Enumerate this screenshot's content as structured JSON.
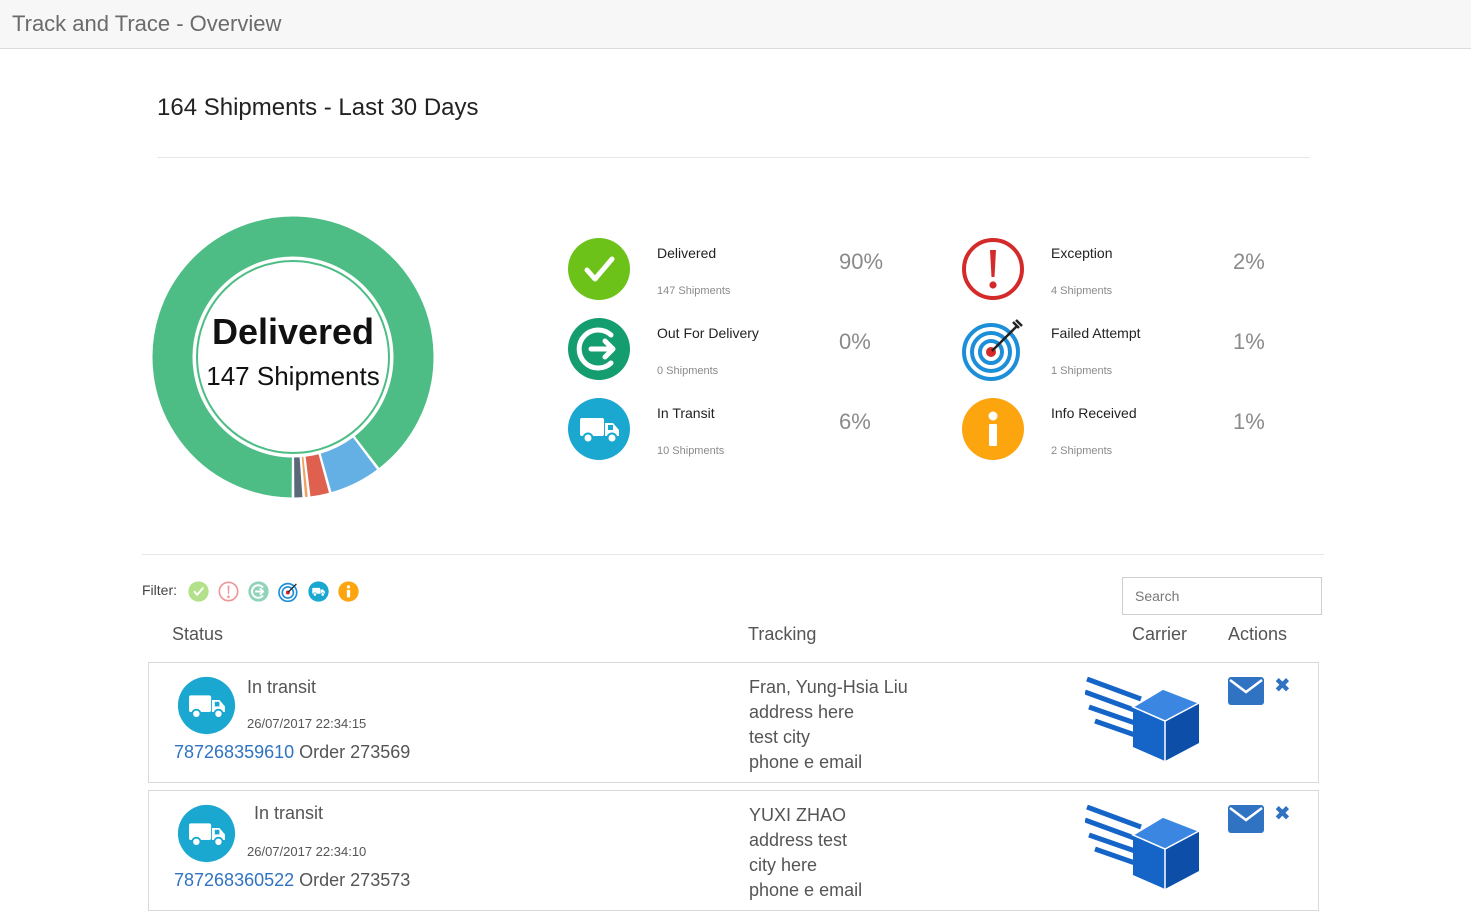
{
  "app": {
    "title": "Track and Trace - Overview"
  },
  "summary": {
    "headline": "164 Shipments - Last 30 Days"
  },
  "donut": {
    "center_title": "Delivered",
    "center_subtitle": "147 Shipments",
    "segments": [
      {
        "status": "Delivered",
        "count": 147,
        "color": "#4dbd85"
      },
      {
        "status": "Out For Delivery",
        "count": 0,
        "color": "#1aa06b"
      },
      {
        "status": "In Transit",
        "count": 10,
        "color": "#64b0e4"
      },
      {
        "status": "Exception",
        "count": 4,
        "color": "#e06050"
      },
      {
        "status": "Failed Attempt",
        "count": 1,
        "color": "#f0a060"
      },
      {
        "status": "Info Received",
        "count": 2,
        "color": "#5a6878"
      }
    ]
  },
  "stats": [
    {
      "label": "Delivered",
      "sub": "147 Shipments",
      "pct": "90%",
      "icon": "check-icon",
      "color": "#6cc218"
    },
    {
      "label": "Out For Delivery",
      "sub": "0 Shipments",
      "pct": "0%",
      "icon": "out-for-delivery-icon",
      "color": "#149d6e"
    },
    {
      "label": "In Transit",
      "sub": "10 Shipments",
      "pct": "6%",
      "icon": "truck-icon",
      "color": "#1aa8d0"
    },
    {
      "label": "Exception",
      "sub": "4 Shipments",
      "pct": "2%",
      "icon": "exclamation-icon",
      "color": "#d42a2a"
    },
    {
      "label": "Failed Attempt",
      "sub": "1 Shipments",
      "pct": "1%",
      "icon": "target-icon",
      "color": "#1d8fd8"
    },
    {
      "label": "Info Received",
      "sub": "2 Shipments",
      "pct": "1%",
      "icon": "info-icon",
      "color": "#fda50f"
    }
  ],
  "filter": {
    "label": "Filter:",
    "icons": [
      "check-icon",
      "exclamation-icon",
      "out-for-delivery-icon",
      "target-icon",
      "truck-icon",
      "info-icon"
    ]
  },
  "search": {
    "placeholder": "Search"
  },
  "columns": {
    "status": "Status",
    "tracking": "Tracking",
    "carrier": "Carrier",
    "actions": "Actions"
  },
  "rows": [
    {
      "status": "In transit",
      "timestamp": "26/07/2017 22:34:15",
      "tracking_number": "787268359610",
      "order": "Order 273569",
      "name": "Fran, Yung-Hsia Liu",
      "address": "address here",
      "city": "test city",
      "contact": "phone e email"
    },
    {
      "status": "In transit",
      "timestamp": "26/07/2017 22:34:10",
      "tracking_number": "787268360522",
      "order": "Order 273573",
      "name": "YUXI ZHAO",
      "address": "address test",
      "city": "city here",
      "contact": "phone e email"
    }
  ],
  "colors": {
    "link": "#2f73c2",
    "carrier_box": "#1565c8"
  }
}
